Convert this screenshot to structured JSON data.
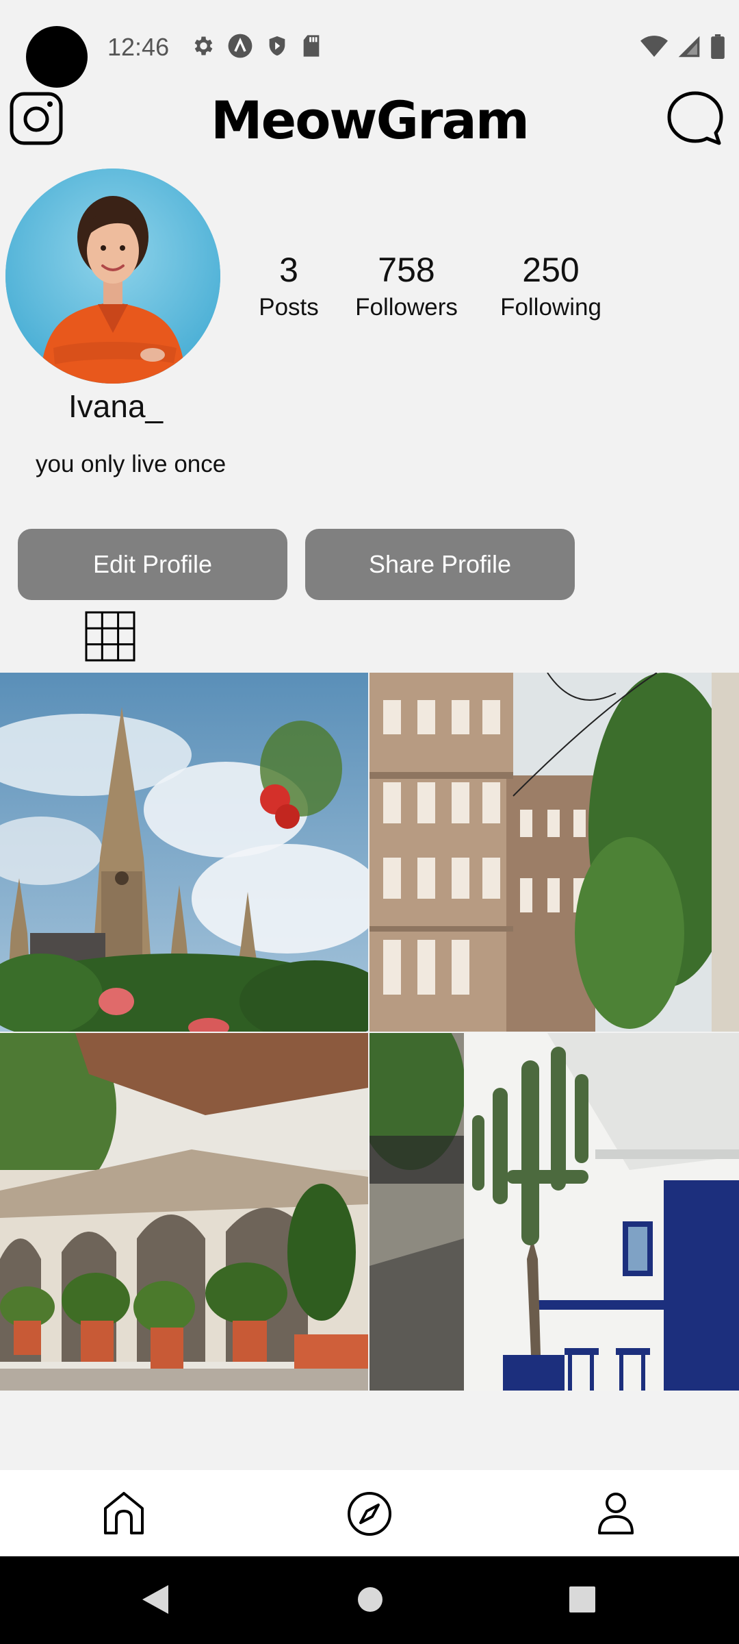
{
  "status_bar": {
    "time": "12:46",
    "icons_left": [
      "gear-icon",
      "a-badge-icon",
      "shield-icon",
      "sd-card-icon"
    ],
    "icons_right": [
      "wifi-icon",
      "signal-icon",
      "battery-icon"
    ]
  },
  "header": {
    "title": "MeowGram",
    "left_icon": "instagram-icon",
    "right_icon": "chat-bubble-icon"
  },
  "profile": {
    "username": "Ivana_",
    "bio": "you only live once",
    "stats": [
      {
        "value": "3",
        "label": "Posts"
      },
      {
        "value": "758",
        "label": "Followers"
      },
      {
        "value": "250",
        "label": "Following"
      }
    ],
    "buttons": {
      "edit": "Edit Profile",
      "share": "Share Profile"
    }
  },
  "tabs": {
    "grid_icon": "grid-icon"
  },
  "posts": [
    {
      "subject": "cathedral spire with flowers"
    },
    {
      "subject": "street with buildings and tree"
    },
    {
      "subject": "arcade with potted plants"
    },
    {
      "subject": "cactus against white wall with blue door"
    }
  ],
  "bottom_nav": {
    "items": [
      {
        "icon": "home-icon"
      },
      {
        "icon": "compass-icon"
      },
      {
        "icon": "profile-icon"
      }
    ]
  },
  "system_nav": {
    "items": [
      "back-icon",
      "home-circle-icon",
      "recents-icon"
    ]
  },
  "colors": {
    "background": "#f2f2f2",
    "button": "#808080",
    "avatar_bg": "#5bb8da",
    "nav_bar": "#000000"
  }
}
